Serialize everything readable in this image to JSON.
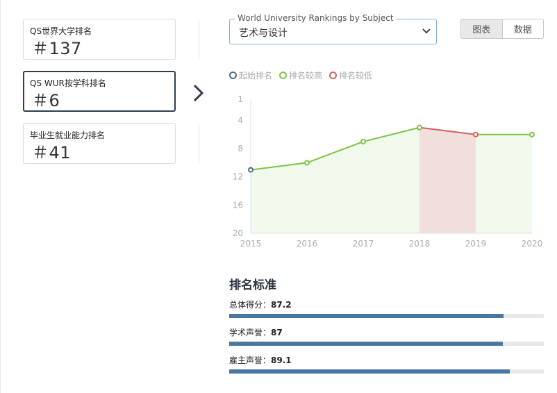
{
  "cards": [
    {
      "label": "QS世界大学排名",
      "value": "＃137"
    },
    {
      "label": "QS WUR按学科排名",
      "value": "＃6"
    },
    {
      "label": "毕业生就业能力排名",
      "value": "＃41"
    }
  ],
  "subject_select": {
    "legend": "World University Rankings by Subject",
    "value": "艺术与设计"
  },
  "view_toggle": {
    "chart": "图表",
    "data": "数据"
  },
  "legend": {
    "start": "起始排名",
    "higher": "排名较高",
    "lower": "排名较低",
    "colors": {
      "start": "#4a6d8c",
      "higher": "#7cc242",
      "lower": "#d35f5f"
    }
  },
  "chart_data": {
    "type": "line",
    "x": [
      "2015",
      "2016",
      "2017",
      "2018",
      "2019",
      "2020"
    ],
    "values": [
      11,
      10,
      7,
      5,
      6,
      6
    ],
    "y_ticks": [
      "1",
      "4",
      "8",
      "12",
      "16",
      "20"
    ],
    "y_inverted": true,
    "ylim": [
      1,
      20
    ],
    "colors": {
      "up": "#7cc242",
      "down": "#d35f5f",
      "start": "#4a6d8c",
      "fill_up": "#f1f8ec",
      "fill_down": "#f3dede"
    }
  },
  "criteria": {
    "title": "排名标准",
    "items": [
      {
        "label": "总体得分：",
        "value": "87.2",
        "percent": 87.2
      },
      {
        "label": "学术声誉：",
        "value": "87",
        "percent": 87
      },
      {
        "label": "雇主声誉：",
        "value": "89.1",
        "percent": 89.1
      }
    ]
  }
}
